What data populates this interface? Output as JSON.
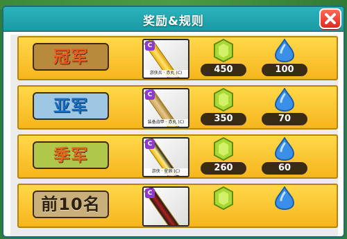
{
  "dialog": {
    "title": "奖励&规则",
    "close_icon": "close-icon"
  },
  "colors": {
    "header": "#1a9aa5",
    "row": "#ffd84a",
    "close": "#e0291f",
    "gold_reward": "#b4e23a",
    "gem_reward": "#3a8fe8"
  },
  "rewards": [
    {
      "rank": "冠军",
      "item_name": "游侠兵 · 赤丸 (C)",
      "item_grade": "C",
      "gold": "450",
      "gems": "100"
    },
    {
      "rank": "亚军",
      "item_name": "装备战甲 · 赤丸 (C)",
      "item_grade": "C",
      "gold": "350",
      "gems": "70"
    },
    {
      "rank": "季军",
      "item_name": "游侠 · 星辰 (C)",
      "item_grade": "C",
      "gold": "260",
      "gems": "60"
    },
    {
      "rank": "前10名",
      "item_name": "",
      "item_grade": "C",
      "gold": "",
      "gems": ""
    }
  ]
}
